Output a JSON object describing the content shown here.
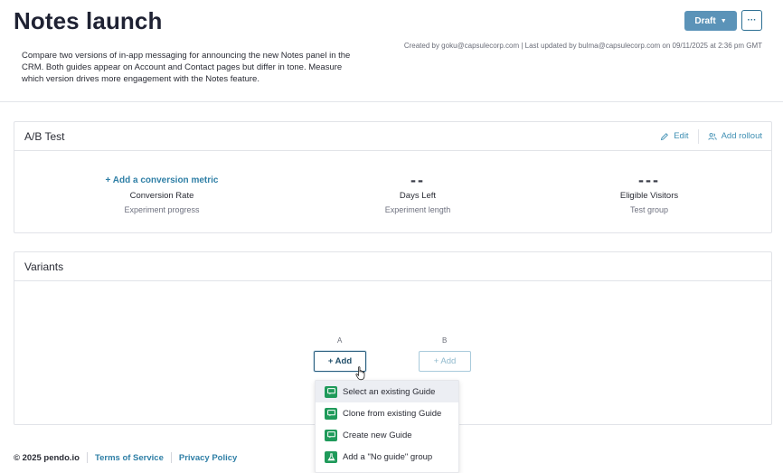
{
  "header": {
    "title": "Notes launch",
    "description": "Compare two versions of in-app messaging for announcing the new Notes panel in the CRM. Both guides appear on Account and Contact pages but differ in tone. Measure which version drives more engagement with the Notes feature.",
    "meta": "Created by goku@capsulecorp.com | Last updated by bulma@capsulecorp.com on 09/11/2025 at 2:36 pm GMT",
    "draft_label": "Draft",
    "more_label": "···"
  },
  "ab_test": {
    "title": "A/B Test",
    "edit_label": "Edit",
    "add_rollout_label": "Add rollout",
    "metrics": [
      {
        "top": "+ Add a conversion metric",
        "label": "Conversion Rate",
        "sub": "Experiment progress"
      },
      {
        "top": "--",
        "label": "Days Left",
        "sub": "Experiment length"
      },
      {
        "top": "---",
        "label": "Eligible Visitors",
        "sub": "Test group"
      }
    ]
  },
  "variants": {
    "title": "Variants",
    "items": [
      {
        "letter": "A",
        "add_label": "+ Add"
      },
      {
        "letter": "B",
        "add_label": "+ Add"
      }
    ]
  },
  "dropdown": {
    "items": [
      {
        "label": "Select an existing Guide",
        "icon": "guide-icon"
      },
      {
        "label": "Clone from existing Guide",
        "icon": "guide-icon"
      },
      {
        "label": "Create new Guide",
        "icon": "guide-icon"
      },
      {
        "label": "Add a \"No guide\" group",
        "icon": "flask-icon"
      }
    ]
  },
  "footer": {
    "copyright": "© 2025 pendo.io",
    "terms": "Terms of Service",
    "privacy": "Privacy Policy"
  },
  "colors": {
    "accent": "#2f7fa6",
    "draft_button": "#5b93b8",
    "guide_icon": "#1f9a5a"
  }
}
